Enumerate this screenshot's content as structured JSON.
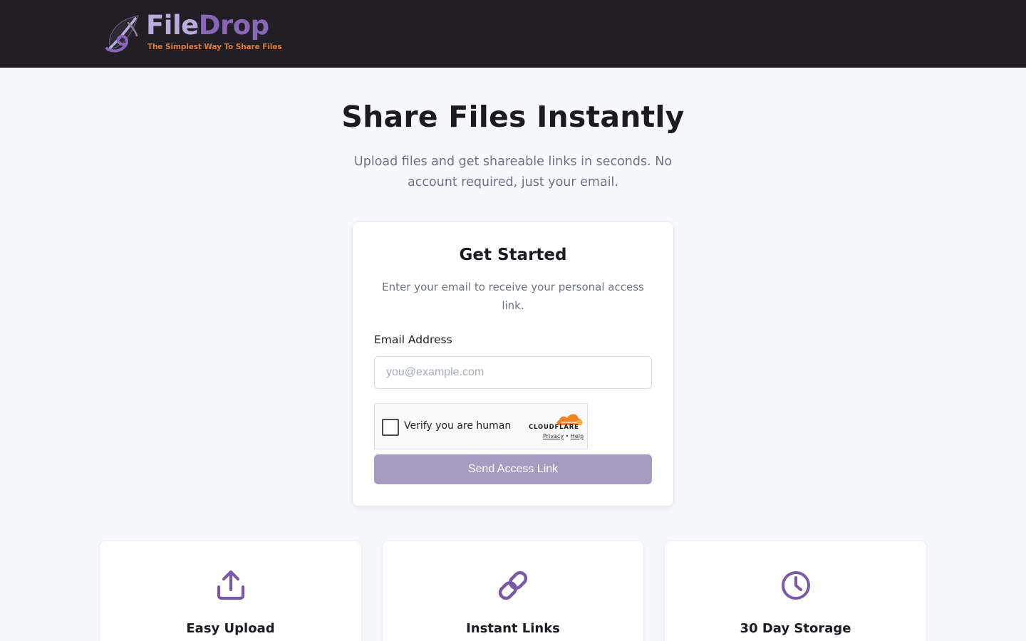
{
  "header": {
    "brand_part1": "File",
    "brand_part2": "Drop",
    "tagline": "The Simplest Way To Share Files",
    "logo_icon": "feather-logo-icon"
  },
  "hero": {
    "title": "Share Files Instantly",
    "subtitle": "Upload files and get shareable links in seconds. No account required, just your email."
  },
  "signup_card": {
    "title": "Get Started",
    "description": "Enter your email to receive your personal access link.",
    "email_label": "Email Address",
    "email_placeholder": "you@example.com",
    "email_value": "",
    "captcha": {
      "label": "Verify you are human",
      "brand": "CLOUDFLARE",
      "privacy_link": "Privacy",
      "separator": "•",
      "help_link": "Help",
      "checked": false
    },
    "submit_label": "Send Access Link",
    "submit_enabled": false
  },
  "features": [
    {
      "icon": "upload-icon",
      "title": "Easy Upload"
    },
    {
      "icon": "link-icon",
      "title": "Instant Links"
    },
    {
      "icon": "clock-icon",
      "title": "30 Day Storage"
    }
  ],
  "colors": {
    "header_bg": "#211f25",
    "page_bg": "#f7f8fc",
    "accent": "#8866b8",
    "brand_light": "#b8aedd",
    "tagline": "#e27a34",
    "button_disabled": "#a79bc2",
    "icon": "#7a5aa8",
    "muted_text": "#6c7282"
  }
}
